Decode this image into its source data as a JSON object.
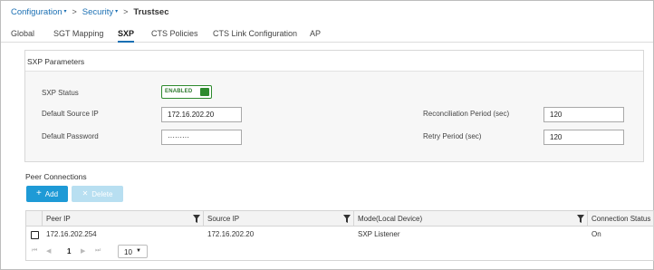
{
  "breadcrumb": {
    "items": [
      {
        "label": "Configuration"
      },
      {
        "label": "Security"
      }
    ],
    "current": "Trustsec",
    "separator": ">",
    "caret": "▾"
  },
  "tabs": [
    {
      "label": "Global",
      "active": false
    },
    {
      "label": "SGT Mapping",
      "active": false
    },
    {
      "label": "SXP",
      "active": true
    },
    {
      "label": "CTS Policies",
      "active": false
    },
    {
      "label": "CTS Link Configuration",
      "active": false
    },
    {
      "label": "AP",
      "active": false
    }
  ],
  "sxp_parameters": {
    "title": "SXP Parameters",
    "status_label": "SXP Status",
    "status_value": "ENABLED",
    "default_source_ip_label": "Default Source IP",
    "default_source_ip_value": "172.16.202.20",
    "default_password_label": "Default Password",
    "default_password_value": "·········",
    "reconciliation_label": "Reconciliation Period (sec)",
    "reconciliation_value": "120",
    "retry_label": "Retry Period (sec)",
    "retry_value": "120"
  },
  "peer_connections": {
    "title": "Peer Connections",
    "add_label": "Add",
    "delete_label": "Delete",
    "add_icon": "+",
    "delete_icon": "✕",
    "columns": [
      "Peer IP",
      "Source IP",
      "Mode(Local Device)",
      "Connection Status"
    ],
    "rows": [
      {
        "peer_ip": "172.16.202.254",
        "source_ip": "172.16.202.20",
        "mode": "SXP Listener",
        "status": "On"
      }
    ],
    "pager": {
      "first": "⏮",
      "prev": "◀",
      "page": "1",
      "next": "▶",
      "last": "⏭",
      "page_size": "10",
      "page_size_caret": "▼"
    }
  },
  "colors": {
    "link": "#1a6fb3",
    "enabled_green": "#2e8b2e",
    "add_button": "#1e9ad6",
    "delete_button_disabled": "#b8dff1"
  }
}
